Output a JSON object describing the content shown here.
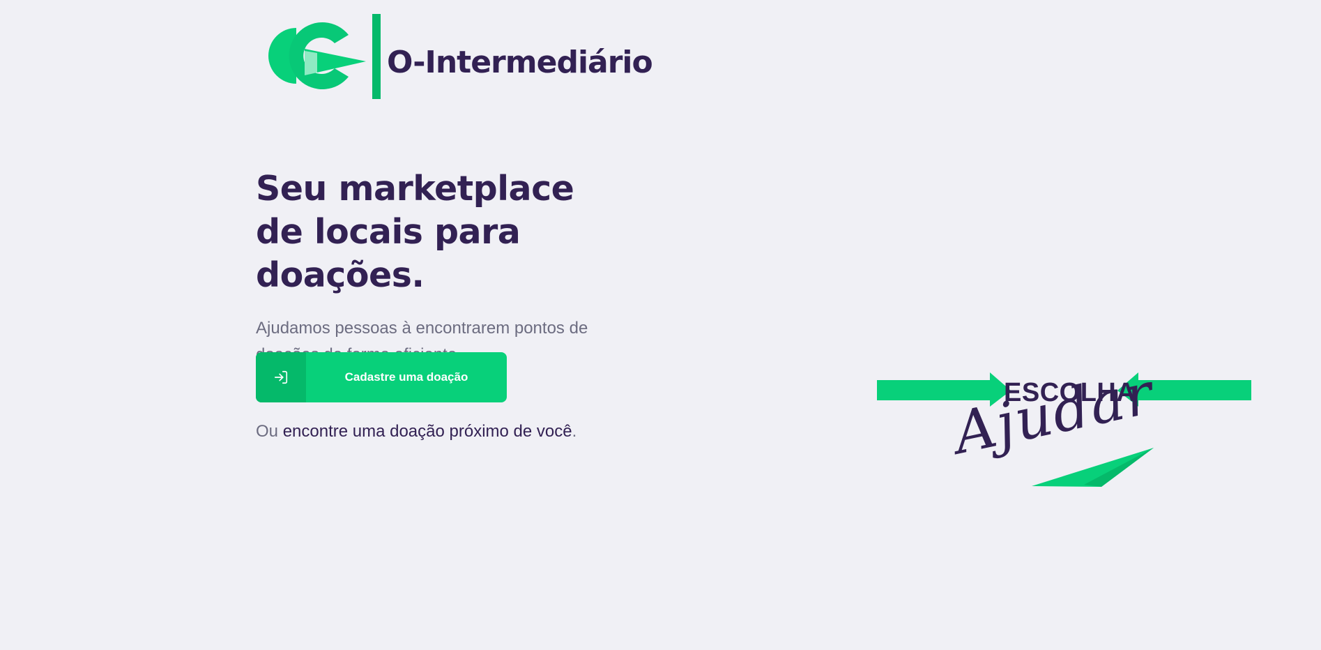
{
  "header": {
    "logo_text": "O-Intermediário"
  },
  "hero": {
    "title": "Seu marketplace de locais para doações.",
    "subtitle": "Ajudamos pessoas à encontrarem pontos de doações de forma eficiente."
  },
  "cta": {
    "label": "Cadastre uma doação",
    "icon": "log-in-icon"
  },
  "alt_link": {
    "prefix": "Ou ",
    "link_text": "encontre uma doação próximo de você",
    "suffix": "."
  },
  "illustration": {
    "top_word": "ESCOLHA",
    "script_word": "Ajudar"
  },
  "colors": {
    "background": "#f0f0f5",
    "primary_green": "#08d07a",
    "dark_green": "#05b96a",
    "title_purple": "#322153",
    "text_gray": "#6c6c80"
  }
}
